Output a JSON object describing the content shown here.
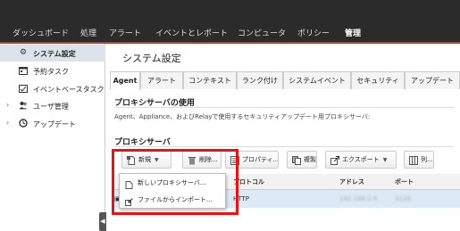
{
  "nav": {
    "items": [
      "ダッシュボード",
      "処理",
      "アラート",
      "イベントとレポート",
      "コンピュータ",
      "ポリシー",
      "管理"
    ],
    "active_index": 6
  },
  "sidebar": {
    "items": [
      {
        "label": "システム設定",
        "icon": "gear-icon"
      },
      {
        "label": "予約タスク",
        "icon": "calendar-icon"
      },
      {
        "label": "イベントベースタスク",
        "icon": "event-task-icon"
      },
      {
        "label": "ユーザ管理",
        "icon": "users-icon"
      },
      {
        "label": "アップデート",
        "icon": "update-icon"
      }
    ]
  },
  "main": {
    "title": "システム設定",
    "tabs": [
      "Agent",
      "アラート",
      "コンテキスト",
      "ランク付け",
      "システムイベント",
      "セキュリティ",
      "アップデート"
    ],
    "proxy_usage_title": "プロキシサーバの使用",
    "proxy_usage_desc": "Agent、Appliance、およびRelayで使用するセキュリティアップデート用プロキシサーバ:",
    "proxy_servers_title": "プロキシサーバ"
  },
  "toolbar": {
    "new_label": "新規",
    "delete_label": "削除...",
    "properties_label": "プロパティ...",
    "duplicate_label": "複製",
    "export_label": "エクスポート",
    "columns_label": "列..."
  },
  "table": {
    "headers": [
      "プロトコル",
      "アドレス",
      "ポート"
    ],
    "rows": [
      {
        "protocol": "HTTP",
        "address": "192.168.1.4",
        "port": "3128"
      }
    ]
  },
  "dropdown": {
    "items": [
      "新しいプロキシサーバ...",
      "ファイルからインポート..."
    ]
  },
  "colors": {
    "nav_bg": "#2b2b2b",
    "accent_red": "#c0392b",
    "highlight": "#ee1111",
    "selected_row": "#dce9f6"
  }
}
